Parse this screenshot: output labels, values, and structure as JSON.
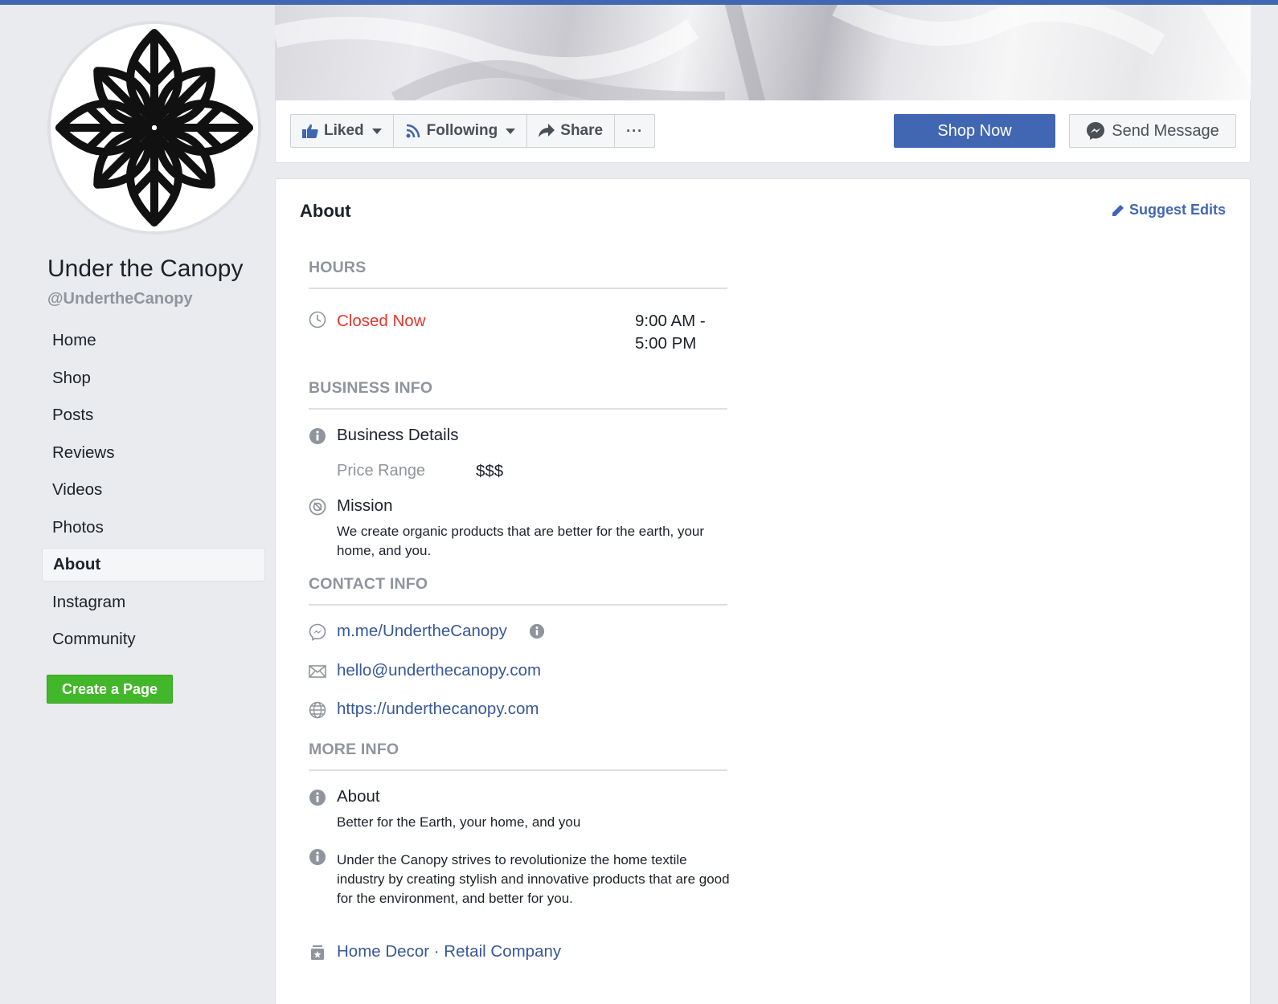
{
  "colors": {
    "brand_blue": "#4267b2",
    "link_blue": "#385898",
    "create_green": "#42b72a",
    "closed_red": "#e4372c"
  },
  "page": {
    "name": "Under the Canopy",
    "handle": "@UndertheCanopy"
  },
  "nav": {
    "items": [
      {
        "label": "Home"
      },
      {
        "label": "Shop"
      },
      {
        "label": "Posts"
      },
      {
        "label": "Reviews"
      },
      {
        "label": "Videos"
      },
      {
        "label": "Photos"
      },
      {
        "label": "About",
        "active": true
      },
      {
        "label": "Instagram"
      },
      {
        "label": "Community"
      }
    ],
    "create_page": "Create a Page"
  },
  "actions": {
    "liked": "Liked",
    "following": "Following",
    "share": "Share",
    "more": "···",
    "shop_now": "Shop Now",
    "send_message": "Send Message"
  },
  "about": {
    "title": "About",
    "suggest_edits": "Suggest Edits",
    "hours": {
      "heading": "HOURS",
      "status": "Closed Now",
      "time_line1": "9:00 AM -",
      "time_line2": "5:00 PM"
    },
    "business_info": {
      "heading": "BUSINESS INFO",
      "details_label": "Business Details",
      "price_range_label": "Price Range",
      "price_range_value": "$$$",
      "mission_label": "Mission",
      "mission_text": "We create organic products that are better for the earth, your home, and you."
    },
    "contact_info": {
      "heading": "CONTACT INFO",
      "messenger": "m.me/UndertheCanopy",
      "email": "hello@underthecanopy.com",
      "website": "https://underthecanopy.com"
    },
    "more_info": {
      "heading": "MORE INFO",
      "about_label": "About",
      "about_text": "Better for the Earth, your home, and you",
      "description": "Under the Canopy strives to revolutionize the home textile industry by creating stylish and innovative products that are good for the environment, and better for you.",
      "categories": "Home Decor · Retail Company"
    }
  }
}
